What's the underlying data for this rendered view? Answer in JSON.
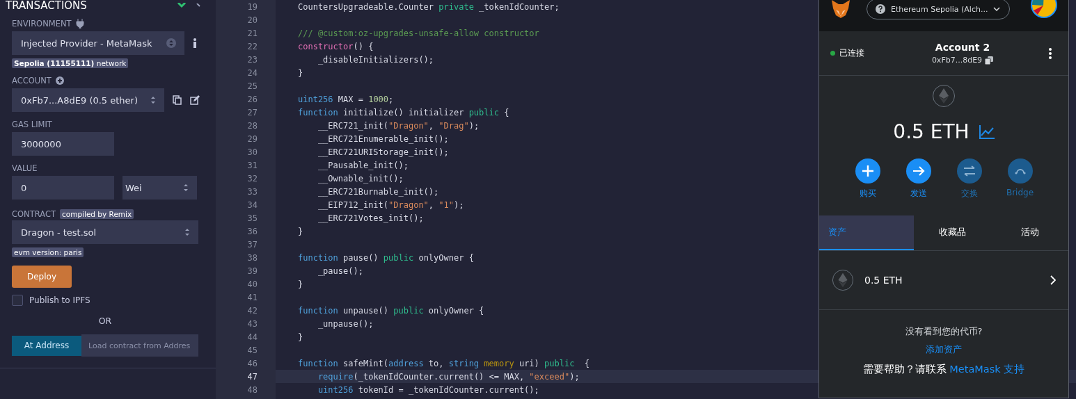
{
  "sidebar": {
    "title": "TRANSACTIONS",
    "environment": {
      "label": "ENVIRONMENT",
      "value": "Injected Provider - MetaMask",
      "network_badge": "**Sepolia (11155111)** network"
    },
    "account": {
      "label": "ACCOUNT",
      "value": "0xFb7...A8dE9 (0.5 ether)"
    },
    "gas_limit": {
      "label": "GAS LIMIT",
      "value": "3000000"
    },
    "value": {
      "label": "VALUE",
      "amount": "0",
      "unit": "Wei"
    },
    "contract": {
      "label": "CONTRACT",
      "badge": "compiled by Remix",
      "value": "Dragon - test.sol",
      "evm_badge": "evm version: paris"
    },
    "deploy_button": "Deploy",
    "publish": {
      "label": "Publish to IPFS",
      "checked": false
    },
    "or": "OR",
    "at_address_button": "At Address",
    "load_placeholder": "Load contract from Addres"
  },
  "editor": {
    "lines": [
      {
        "number": "19",
        "current": false,
        "tokens": [
          {
            "kind": "plain",
            "text": "CountersUpgradeable.Counter "
          },
          {
            "kind": "mod",
            "text": "private"
          },
          {
            "kind": "plain",
            "text": " _tokenIdCounter;"
          }
        ]
      },
      {
        "number": "20",
        "current": false
      },
      {
        "number": "21",
        "current": false,
        "tokens": [
          {
            "kind": "comment",
            "text": "/// @custom:oz-upgrades-unsafe-allow constructor"
          }
        ]
      },
      {
        "number": "22",
        "current": false,
        "tokens": [
          {
            "kind": "ctor",
            "text": "constructor"
          },
          {
            "kind": "plain",
            "text": "() {"
          }
        ]
      },
      {
        "number": "23",
        "current": false,
        "tokens": [
          {
            "kind": "plain",
            "text": "    _disableInitializers();"
          }
        ]
      },
      {
        "number": "24",
        "current": false,
        "tokens": [
          {
            "kind": "plain",
            "text": "}"
          }
        ]
      },
      {
        "number": "25",
        "current": false
      },
      {
        "number": "26",
        "current": false,
        "tokens": [
          {
            "kind": "type",
            "text": "uint256"
          },
          {
            "kind": "plain",
            "text": " MAX = "
          },
          {
            "kind": "num",
            "text": "1000"
          },
          {
            "kind": "plain",
            "text": ";"
          }
        ]
      },
      {
        "number": "27",
        "current": false,
        "tokens": [
          {
            "kind": "type",
            "text": "function"
          },
          {
            "kind": "plain",
            "text": " initialize() initializer "
          },
          {
            "kind": "mod",
            "text": "public"
          },
          {
            "kind": "plain",
            "text": " {"
          }
        ]
      },
      {
        "number": "28",
        "current": false,
        "tokens": [
          {
            "kind": "plain",
            "text": "    __ERC721_init("
          },
          {
            "kind": "str",
            "text": "\"Dragon\""
          },
          {
            "kind": "plain",
            "text": ", "
          },
          {
            "kind": "str",
            "text": "\"Drag\""
          },
          {
            "kind": "plain",
            "text": ");"
          }
        ]
      },
      {
        "number": "29",
        "current": false,
        "tokens": [
          {
            "kind": "plain",
            "text": "    __ERC721Enumerable_init();"
          }
        ]
      },
      {
        "number": "30",
        "current": false,
        "tokens": [
          {
            "kind": "plain",
            "text": "    __ERC721URIStorage_init();"
          }
        ]
      },
      {
        "number": "31",
        "current": false,
        "tokens": [
          {
            "kind": "plain",
            "text": "    __Pausable_init();"
          }
        ]
      },
      {
        "number": "32",
        "current": false,
        "tokens": [
          {
            "kind": "plain",
            "text": "    __Ownable_init();"
          }
        ]
      },
      {
        "number": "33",
        "current": false,
        "tokens": [
          {
            "kind": "plain",
            "text": "    __ERC721Burnable_init();"
          }
        ]
      },
      {
        "number": "34",
        "current": false,
        "tokens": [
          {
            "kind": "plain",
            "text": "    __EIP712_init("
          },
          {
            "kind": "str",
            "text": "\"Dragon\""
          },
          {
            "kind": "plain",
            "text": ", "
          },
          {
            "kind": "str",
            "text": "\"1\""
          },
          {
            "kind": "plain",
            "text": ");"
          }
        ]
      },
      {
        "number": "35",
        "current": false,
        "tokens": [
          {
            "kind": "plain",
            "text": "    __ERC721Votes_init();"
          }
        ]
      },
      {
        "number": "36",
        "current": false,
        "tokens": [
          {
            "kind": "plain",
            "text": "}"
          }
        ]
      },
      {
        "number": "37",
        "current": false
      },
      {
        "number": "38",
        "current": false,
        "tokens": [
          {
            "kind": "type",
            "text": "function"
          },
          {
            "kind": "plain",
            "text": " pause() "
          },
          {
            "kind": "mod",
            "text": "public"
          },
          {
            "kind": "plain",
            "text": " onlyOwner {"
          }
        ]
      },
      {
        "number": "39",
        "current": false,
        "tokens": [
          {
            "kind": "plain",
            "text": "    _pause();"
          }
        ]
      },
      {
        "number": "40",
        "current": false,
        "tokens": [
          {
            "kind": "plain",
            "text": "}"
          }
        ]
      },
      {
        "number": "41",
        "current": false
      },
      {
        "number": "42",
        "current": false,
        "tokens": [
          {
            "kind": "type",
            "text": "function"
          },
          {
            "kind": "plain",
            "text": " unpause() "
          },
          {
            "kind": "mod",
            "text": "public"
          },
          {
            "kind": "plain",
            "text": " onlyOwner {"
          }
        ]
      },
      {
        "number": "43",
        "current": false,
        "tokens": [
          {
            "kind": "plain",
            "text": "    _unpause();"
          }
        ]
      },
      {
        "number": "44",
        "current": false,
        "tokens": [
          {
            "kind": "plain",
            "text": "}"
          }
        ]
      },
      {
        "number": "45",
        "current": false
      },
      {
        "number": "46",
        "current": false,
        "tokens": [
          {
            "kind": "type",
            "text": "function"
          },
          {
            "kind": "plain",
            "text": " safeMint("
          },
          {
            "kind": "type",
            "text": "address"
          },
          {
            "kind": "plain",
            "text": " to, "
          },
          {
            "kind": "type",
            "text": "string"
          },
          {
            "kind": "storage",
            "text": " memory"
          },
          {
            "kind": "plain",
            "text": " uri) "
          },
          {
            "kind": "mod",
            "text": "public"
          },
          {
            "kind": "plain",
            "text": "  {"
          }
        ]
      },
      {
        "number": "47",
        "current": true,
        "tokens": [
          {
            "kind": "type",
            "text": "    require"
          },
          {
            "kind": "plain",
            "text": "(_tokenIdCounter.current() <= MAX, "
          },
          {
            "kind": "str",
            "text": "\"exceed\""
          },
          {
            "kind": "plain",
            "text": ");"
          }
        ]
      },
      {
        "number": "48",
        "current": false,
        "tokens": [
          {
            "kind": "type",
            "text": "    uint256"
          },
          {
            "kind": "plain",
            "text": " tokenId = _tokenIdCounter.current();"
          }
        ]
      }
    ]
  },
  "wallet": {
    "network": "Ethereum Sepolia (Alch...",
    "status": "已连接",
    "account_name": "Account 2",
    "address": "0xFb7...8dE9",
    "balance": "0.5 ETH",
    "actions": [
      {
        "kind": "buy",
        "label": "购买",
        "disabled": false
      },
      {
        "kind": "send",
        "label": "发送",
        "disabled": false
      },
      {
        "kind": "swap",
        "label": "交换",
        "disabled": true
      },
      {
        "kind": "bridge",
        "label": "Bridge",
        "disabled": true
      }
    ],
    "tabs": [
      {
        "label": "资产",
        "selected": true
      },
      {
        "label": "收藏品",
        "selected": false
      },
      {
        "label": "活动",
        "selected": false
      }
    ],
    "assets": [
      {
        "amount": "0.5 ETH"
      }
    ],
    "missing_tokens": "没有看到您的代币?",
    "add_asset_link": "添加资产",
    "help": {
      "text": "需要帮助？请联系",
      "link": "MetaMask 支持"
    }
  }
}
